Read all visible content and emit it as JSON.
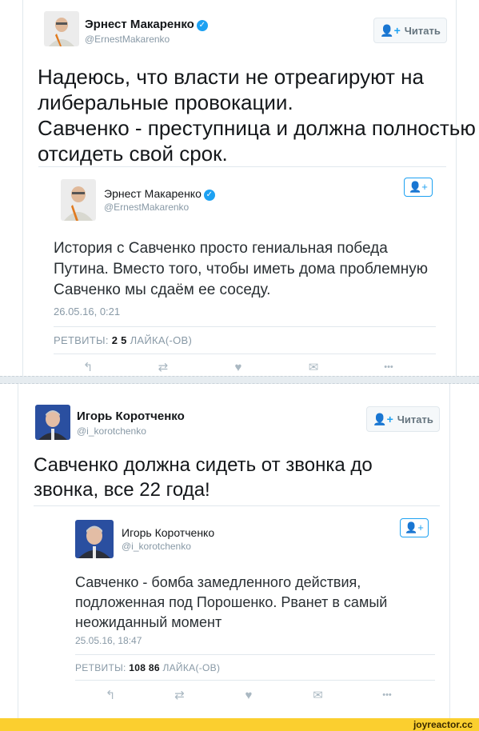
{
  "tweet1": {
    "author_name": "Эрнест Макаренко",
    "author_handle": "@ErnestMakarenko",
    "follow_label": "Читать",
    "text_lines": [
      "Надеюсь, что власти не отреагируют на",
      "либеральные провокации.",
      "Савченко - преступница и должна полностью",
      "отсидеть свой срок."
    ],
    "quoted": {
      "author_name": "Эрнест Макаренко",
      "author_handle": "@ErnestMakarenko",
      "text_lines": [
        "История с Савченко просто гениальная победа",
        "Путина. Вместо того, чтобы иметь дома проблемную",
        "Савченко мы сдаём ее соседу."
      ],
      "timestamp": "26.05.16, 0:21",
      "retweets_label": "РЕТВИТЫ:",
      "retweets": "2",
      "likes": "5",
      "likes_label": "ЛАЙКА(-ОВ)"
    }
  },
  "tweet2": {
    "author_name": "Игорь Коротченко",
    "author_handle": "@i_korotchenko",
    "follow_label": "Читать",
    "text_lines": [
      "Савченко должна сидеть от звонка до",
      "звонка, все 22 года!"
    ],
    "quoted": {
      "author_name": "Игорь Коротченко",
      "author_handle": "@i_korotchenko",
      "text_lines": [
        "Савченко - бомба замедленного действия,",
        "подложенная под Порошенко. Рванет в самый",
        "неожиданный момент"
      ],
      "timestamp": "25.05.16, 18:47",
      "retweets_label": "РЕТВИТЫ:",
      "retweets": "108",
      "likes": "86",
      "likes_label": "ЛАЙКА(-ОВ)"
    }
  },
  "icons": {
    "verified": "✓",
    "follow": "👤+",
    "reply": "↰",
    "retweet": "⇄",
    "like": "♥",
    "message": "✉",
    "more": "•••"
  },
  "footer": {
    "site": "joyreactor.cc"
  },
  "colors": {
    "accent": "#1da1f2",
    "footer_bg": "#fbcf2f",
    "muted": "#8899a6"
  }
}
